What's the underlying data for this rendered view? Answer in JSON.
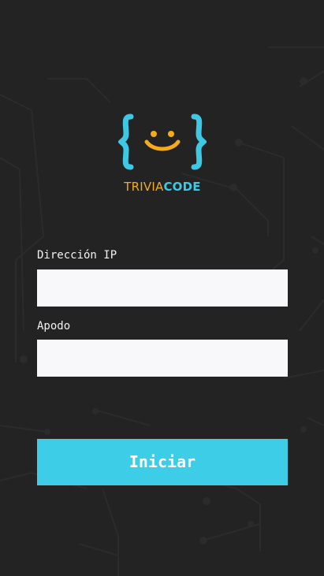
{
  "colors": {
    "background": "#232323",
    "accent": "#3ecde6",
    "logo_orange": "#f4ab1c",
    "input_background": "#f8f8fa"
  },
  "logo": {
    "icon": "smiley-braces-icon",
    "word_part1": "TRIVIA",
    "word_part2": "CODE"
  },
  "form": {
    "ip_label": "Dirección IP",
    "ip_value": "",
    "nick_label": "Apodo",
    "nick_value": ""
  },
  "button": {
    "start_label": "Iniciar"
  }
}
